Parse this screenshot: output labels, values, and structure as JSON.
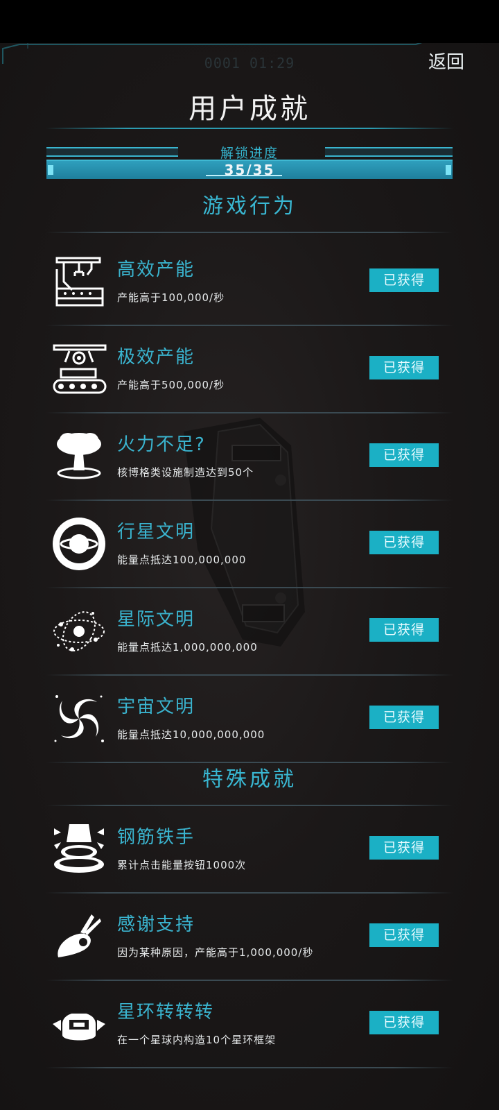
{
  "header": {
    "timer": "0001 01:29",
    "back_label": "返回",
    "title": "用户成就"
  },
  "progress": {
    "label": "解锁进度",
    "text": "35/35",
    "fraction": 1.0
  },
  "sections": [
    {
      "title": "游戏行为",
      "items": [
        {
          "name": "高效产能",
          "desc": "产能高于100,000/秒",
          "status": "已获得",
          "icon": "factory-robot-arm-icon"
        },
        {
          "name": "极效产能",
          "desc": "产能高于500,000/秒",
          "status": "已获得",
          "icon": "conveyor-factory-icon"
        },
        {
          "name": "火力不足?",
          "desc": "核博格类设施制造达到50个",
          "status": "已获得",
          "icon": "mushroom-cloud-icon"
        },
        {
          "name": "行星文明",
          "desc": "能量点抵达100,000,000",
          "status": "已获得",
          "icon": "ringed-planet-icon"
        },
        {
          "name": "星际文明",
          "desc": "能量点抵达1,000,000,000",
          "status": "已获得",
          "icon": "star-system-icon"
        },
        {
          "name": "宇宙文明",
          "desc": "能量点抵达10,000,000,000",
          "status": "已获得",
          "icon": "galaxy-spiral-icon"
        }
      ]
    },
    {
      "title": "特殊成就",
      "items": [
        {
          "name": "钢筋铁手",
          "desc": "累计点击能量按钮1000次",
          "status": "已获得",
          "icon": "press-button-icon"
        },
        {
          "name": "感谢支持",
          "desc": "因为某种原因，产能高于1,000,000/秒",
          "status": "已获得",
          "icon": "ok-hand-icon"
        },
        {
          "name": "星环转转转",
          "desc": "在一个星球内构造10个星环框架",
          "status": "已获得",
          "icon": "star-ring-helmet-icon"
        }
      ]
    }
  ],
  "colors": {
    "accent": "#3ab4cf",
    "badge": "#1bb0c5",
    "background": "#1b1818"
  }
}
